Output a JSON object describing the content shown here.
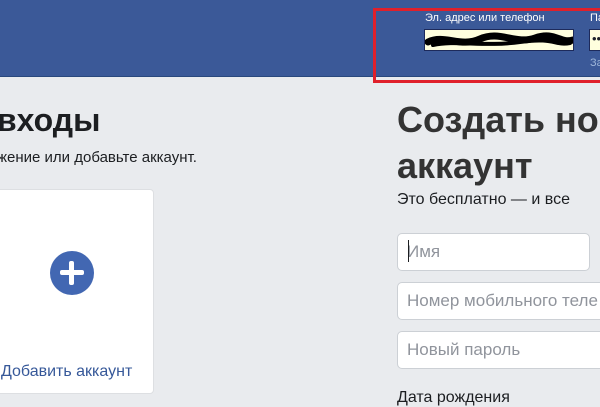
{
  "header": {
    "email_label": "Эл. адрес или телефон",
    "password_label": "Па",
    "password_value": "••",
    "forgot_link": "За",
    "highlight_color": "#e0202b",
    "bar_color": "#3b5998"
  },
  "recent_logins": {
    "title": "входы",
    "subtitle": "жение или добавьте аккаунт.",
    "add_account_label": "Добавить аккаунт",
    "add_icon": "plus-circle-icon"
  },
  "signup": {
    "title_line1": "Создать но",
    "title_line2": "аккаунт",
    "subtitle": "Это бесплатно — и все",
    "first_name_placeholder": "Имя",
    "mobile_placeholder": "Номер мобильного теле",
    "password_placeholder": "Новый пароль",
    "birthday_label": "Дата рождения"
  },
  "colors": {
    "accent": "#4267b2",
    "link": "#365899",
    "background": "#e9ebee"
  }
}
